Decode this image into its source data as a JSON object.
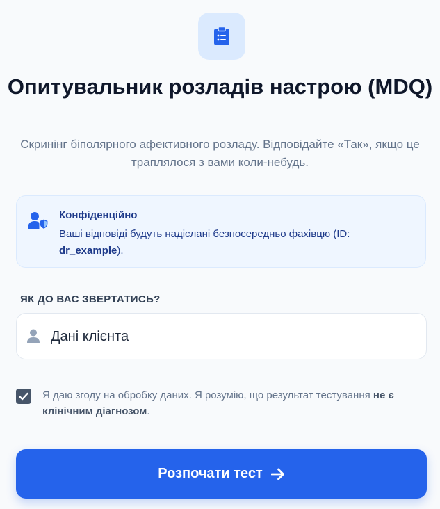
{
  "header": {
    "logo_icon": "clipboard-list-icon",
    "title": "Опитувальник розладів настрою (MDQ)",
    "subtitle": "Скринінг біполярного афективного розладу. Відповідайте «Так», якщо це траплялося з вами коли-небудь."
  },
  "privacy_notice": {
    "icon": "user-shield-icon",
    "title": "Конфіденційно",
    "text_before": "Ваші відповіді будуть надіслані безпосередньо фахівцю (ID: ",
    "specialist_id": "dr_example",
    "text_after": ")."
  },
  "name_field": {
    "label": "ЯК ДО ВАС ЗВЕРТАТИСЬ?",
    "placeholder": "Дані клієнта",
    "value": "",
    "icon": "user-icon"
  },
  "consent": {
    "checked": true,
    "text": "Я даю згоду на обробку даних. Я розумію, що результат тестування ",
    "bold_text": "не є клінічним діагнозом",
    "text_after": "."
  },
  "start_button": {
    "label": "Розпочати тест",
    "icon": "arrow-right-icon"
  },
  "colors": {
    "accent": "#2563eb",
    "background": "#f8fafc",
    "info_bg": "#eff6ff",
    "info_text": "#1e3a8a"
  }
}
